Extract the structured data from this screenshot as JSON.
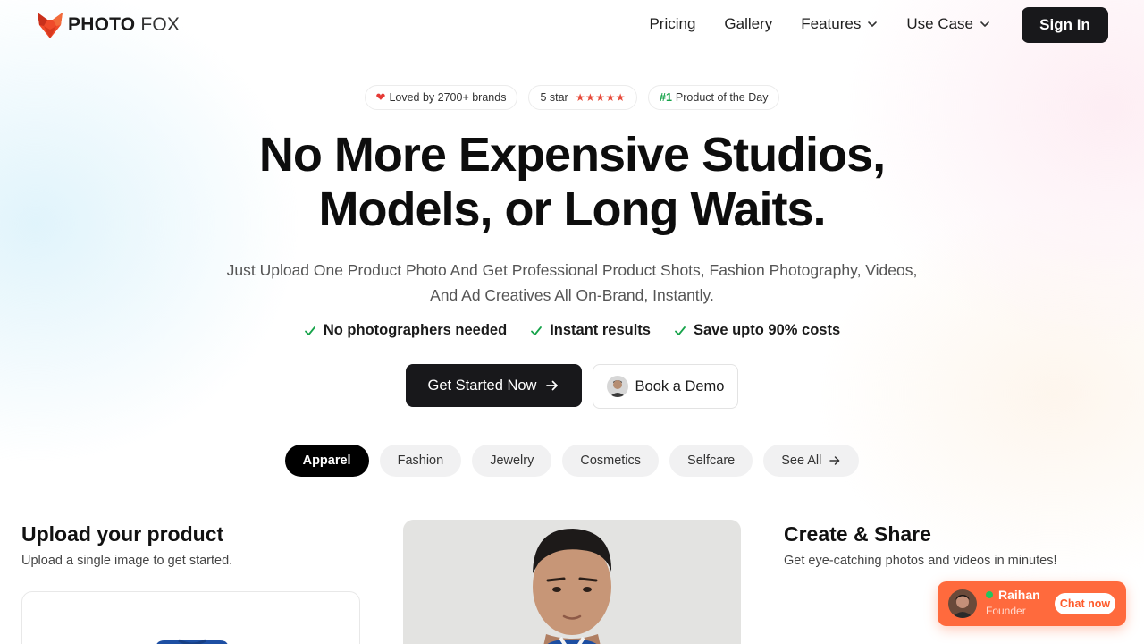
{
  "brand": {
    "name_bold": "PHOTO",
    "name_light": "FOX",
    "accent_color": "#ef4a2a"
  },
  "nav": {
    "links": [
      {
        "label": "Pricing",
        "dropdown": false
      },
      {
        "label": "Gallery",
        "dropdown": false
      },
      {
        "label": "Features",
        "dropdown": true
      },
      {
        "label": "Use Case",
        "dropdown": true
      }
    ],
    "signin_label": "Sign In"
  },
  "badges": {
    "loved": {
      "icon": "heart-icon",
      "text": "Loved by 2700+ brands"
    },
    "rating": {
      "text": "5 star",
      "stars": 5,
      "star_color": "#e74c3c"
    },
    "product_of_day": {
      "rank": "#1",
      "text": "Product of the Day"
    }
  },
  "hero": {
    "headline_line1": "No More Expensive Studios,",
    "headline_line2": "Models, or Long Waits.",
    "subtitle": "Just Upload One Product Photo And Get Professional Product Shots, Fashion Photography, Videos, And Ad Creatives All On-Brand, Instantly.",
    "checks": [
      "No photographers needed",
      "Instant results",
      "Save upto 90% costs"
    ],
    "check_color": "#16a34a",
    "cta_primary": "Get Started Now",
    "cta_secondary": "Book a Demo"
  },
  "categories": {
    "items": [
      "Apparel",
      "Fashion",
      "Jewelry",
      "Cosmetics",
      "Selfcare"
    ],
    "active": "Apparel",
    "see_all": "See All"
  },
  "steps": {
    "upload": {
      "title": "Upload your product",
      "subtitle": "Upload a single image to get started."
    },
    "create": {
      "title": "Create & Share",
      "subtitle": "Get eye-catching photos and videos in minutes!"
    }
  },
  "chat": {
    "name": "Raihan",
    "role": "Founder",
    "button": "Chat now",
    "online": true,
    "color": "#ff6a3d"
  }
}
